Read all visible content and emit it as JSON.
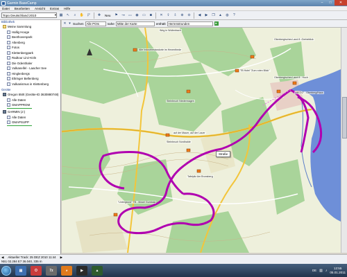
{
  "window": {
    "title": "Garmin BaseCamp",
    "min": "–",
    "max": "□",
    "close": "✕"
  },
  "menu": [
    "Datei",
    "Bearbeiten",
    "Ansicht",
    "Extras",
    "Hilfe"
  ],
  "toolbar": {
    "dataset": "Topo Deutschland 2010",
    "new_label": "Neu"
  },
  "sidebar": {
    "library_heading": "Bibliothek",
    "collection_label": "Meine Sammlung",
    "collection_items": [
      "Hallig Hooge",
      "Beethovenpark",
      "Altenberg",
      "Fotos",
      "Klettenbergpark",
      "Radtour Linz-Köln",
      "Die Odenthaler",
      "Vulkaneifel - Laacher See",
      "Hinglenbergs",
      "Eltringer Bellenberg",
      "Vulkanismus in Klettenberg"
    ],
    "devices_heading": "Geräte",
    "device1_label": "Oregon 550t (Geräte-ID 3630880748)",
    "device1_data": "Alle Daten",
    "device1_drive": "GMAPPROM",
    "device2_label": "GARMIN (J:)",
    "device2_data": "Alle Daten",
    "device2_drive": "GMAPSUPP"
  },
  "search": {
    "label": "Suchen",
    "category": "Alle POIs",
    "near": "nahe",
    "near_target": "Mitte der Karte",
    "contains": "enthält",
    "query": "Herrenstrunden"
  },
  "map": {
    "callout_label": "Straße",
    "place_labels": [
      "Weg in Wullenbach",
      "Alte Industriestandorte im Hexenthede",
      "TB Hotel \"Zum roten Blick\"",
      "Steinbruch Niedermagen",
      "auf der Mauer, auf der Lauer",
      "Steinbruch Nordhalde",
      "Tafelpilz Am Brunsberg",
      "\"Untergrund\" TB - Mosel Gumbala",
      "Oberbergisches Land 8 -Gerbeblick",
      "Oberbergisches Land 8 - Hoch",
      "LBEZ47 - Oberberg/Haus"
    ],
    "track_color": "#b000b0",
    "water_color": "#6e8fd8"
  },
  "status": {
    "track": "Aktueller Track: 25 DEZ 2010 11:44",
    "coords": "N51 02.284 E7 36.040, 335 m"
  },
  "taskbar": {
    "lang": "DE",
    "time": "12:55",
    "date": "05.01.2011"
  }
}
